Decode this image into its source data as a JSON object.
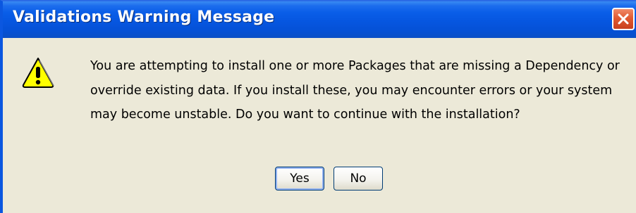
{
  "dialog": {
    "title": "Validations Warning Message",
    "message": "You are attempting to install one or more Packages that are missing a Dependency or override existing data. If you install these, you may encounter errors or your system may become unstable. Do you want to continue with the installation?",
    "icon": "warning-icon",
    "buttons": {
      "yes_label": "Yes",
      "no_label": "No"
    }
  },
  "colors": {
    "titlebar": "#0a5ee8",
    "title_text": "#ffffff",
    "close_button": "#e15a32",
    "dialog_background": "#ece9d8",
    "warning_icon_fill": "#ffff00"
  }
}
